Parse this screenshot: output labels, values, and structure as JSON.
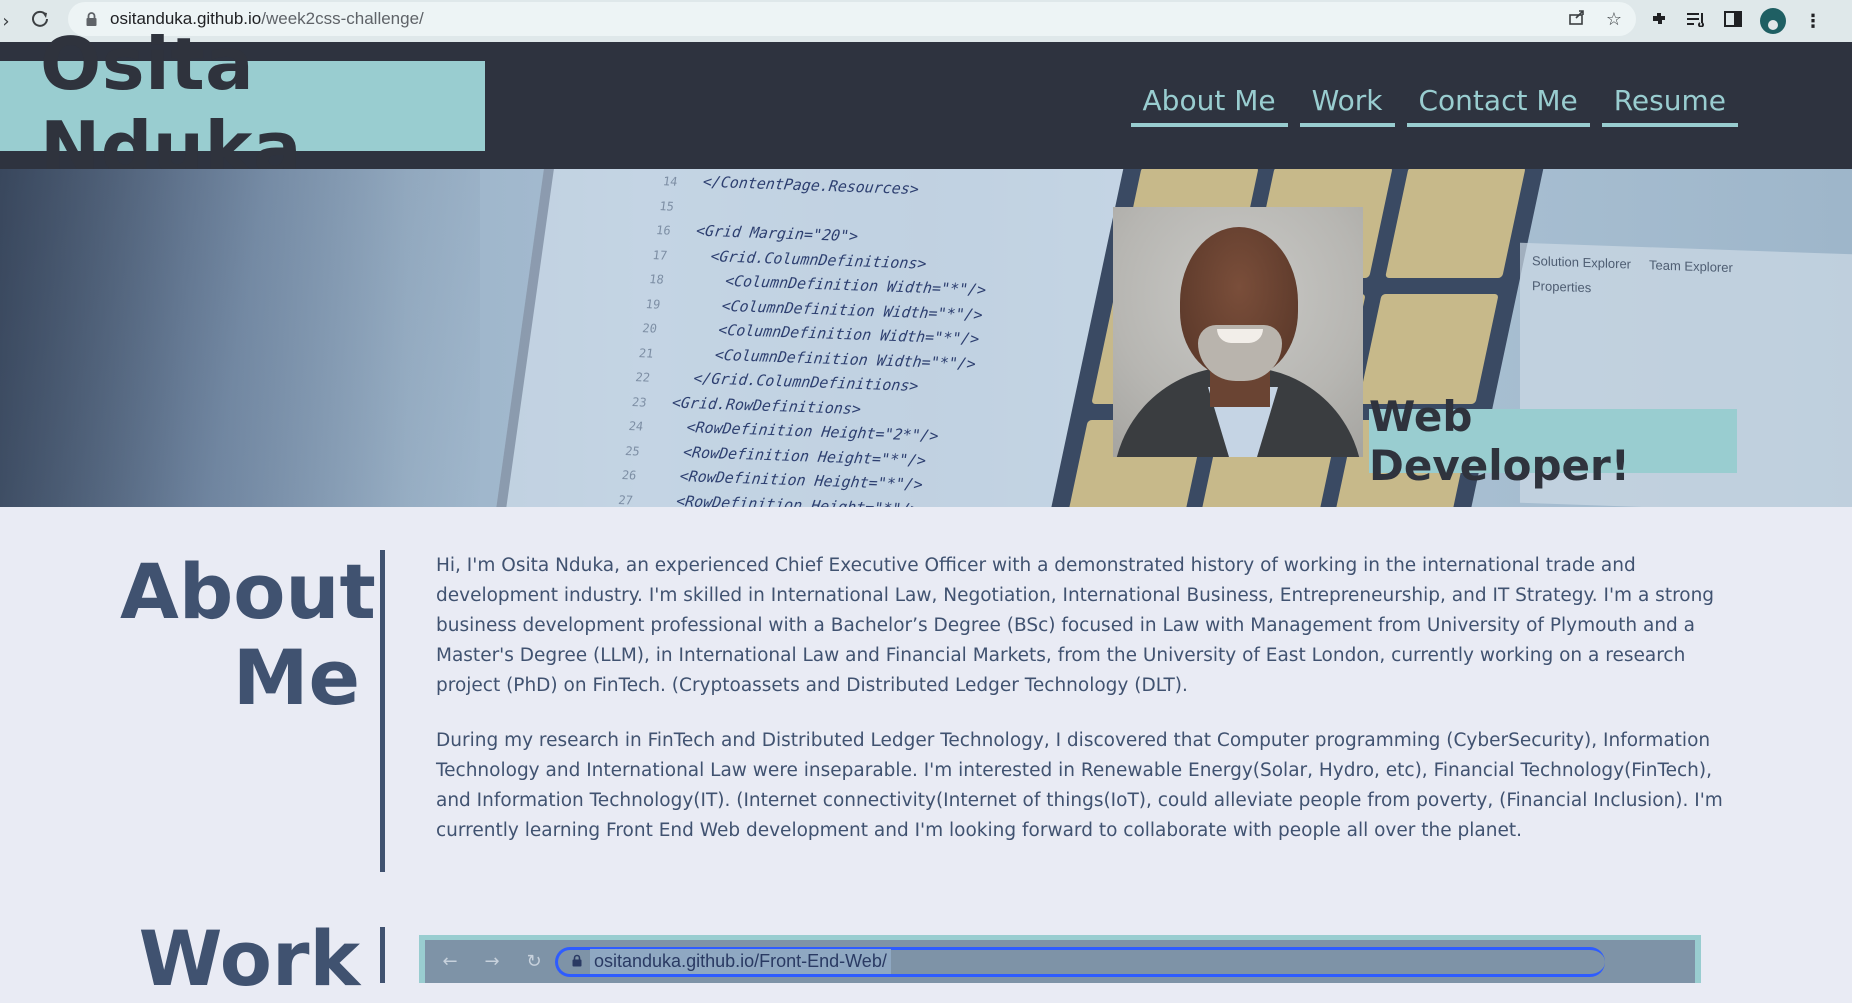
{
  "browser": {
    "url_host": "ositanduka.github.io",
    "url_path": "/week2css-challenge/"
  },
  "site": {
    "name": "Osita Nduka",
    "nav": [
      "About Me",
      "Work",
      "Contact Me",
      "Resume"
    ],
    "tagline": "Web Developer!"
  },
  "hero_code": [
    {
      "n": "14",
      "t": "</ContentPage.Resources>"
    },
    {
      "n": "15",
      "t": ""
    },
    {
      "n": "16",
      "t": "<Grid Margin=\"20\">"
    },
    {
      "n": "17",
      "t": "  <Grid.ColumnDefinitions>"
    },
    {
      "n": "18",
      "t": "    <ColumnDefinition Width=\"*\"/>"
    },
    {
      "n": "19",
      "t": "    <ColumnDefinition Width=\"*\"/>"
    },
    {
      "n": "20",
      "t": "    <ColumnDefinition Width=\"*\"/>"
    },
    {
      "n": "21",
      "t": "    <ColumnDefinition Width=\"*\"/>"
    },
    {
      "n": "22",
      "t": "  </Grid.ColumnDefinitions>"
    },
    {
      "n": "23",
      "t": "<Grid.RowDefinitions>"
    },
    {
      "n": "24",
      "t": "  <RowDefinition Height=\"2*\"/>"
    },
    {
      "n": "25",
      "t": "  <RowDefinition Height=\"*\"/>"
    },
    {
      "n": "26",
      "t": "  <RowDefinition Height=\"*\"/>"
    },
    {
      "n": "27",
      "t": "  <RowDefinition Height=\"*\"/>"
    }
  ],
  "hero_panel": {
    "tab1": "Solution Explorer",
    "tab2": "Team Explorer",
    "properties": "Properties"
  },
  "about": {
    "title_line1": "About",
    "title_line2": "Me",
    "paragraph1": "Hi, I'm Osita Nduka, an experienced Chief Executive Officer with a demonstrated history of working in the international trade and development industry. I'm skilled in International Law, Negotiation, International Business, Entrepreneurship, and IT Strategy. I'm a strong business development professional with a Bachelor’s Degree (BSc) focused in Law with Management from University of Plymouth and a Master's Degree (LLM), in International Law and Financial Markets, from the University of East London, currently working on a research project (PhD) on FinTech. (Cryptoassets and Distributed Ledger Technology (DLT).",
    "paragraph2": "During my research in FinTech and Distributed Ledger Technology, I discovered that Computer programming (CyberSecurity), Information Technology and International Law were inseparable. I'm interested in Renewable Energy(Solar, Hydro, etc), Financial Technology(FinTech), and Information Technology(IT). (Internet connectivity(Internet of things(IoT), could alleviate people from poverty, (Financial Inclusion). I'm currently learning Front End Web development and I'm looking forward to collaborate with people all over the planet."
  },
  "work": {
    "title": "Work",
    "screenshot_url": "ositanduka.github.io/Front-End-Web/"
  },
  "colors": {
    "accent": "#99cdd0",
    "header_bg": "#2e333f",
    "text": "#405270",
    "page_bg": "#e9ebf4"
  }
}
